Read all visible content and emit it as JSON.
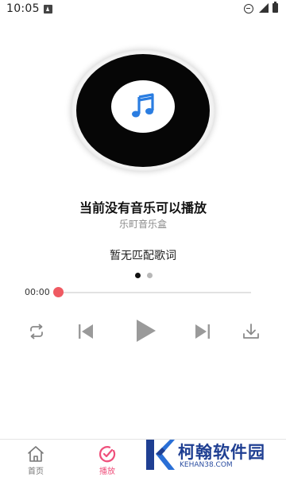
{
  "status_bar": {
    "time": "10:05"
  },
  "player": {
    "song_title": "当前没有音乐可以播放",
    "artist": "乐町音乐盒",
    "lyrics": "暂无匹配歌词",
    "current_time": "00:00",
    "progress": 0,
    "carousel_pages": 2,
    "carousel_active_index": 0
  },
  "controls": {
    "repeat_icon": "repeat-icon",
    "prev_icon": "skip-previous-icon",
    "play_icon": "play-icon",
    "next_icon": "skip-next-icon",
    "download_icon": "download-icon"
  },
  "bottom_nav": {
    "items": [
      {
        "label": "首页",
        "icon": "home-icon",
        "active": false
      },
      {
        "label": "播放",
        "icon": "play-disc-icon",
        "active": true
      }
    ]
  },
  "watermark": {
    "title": "柯翰软件园",
    "subtitle": "KEHAN38.COM"
  },
  "colors": {
    "accent": "#ef4f7b",
    "progress_knob": "#ef5a62",
    "note_icon": "#2a7de1",
    "watermark": "#1f3f92"
  }
}
